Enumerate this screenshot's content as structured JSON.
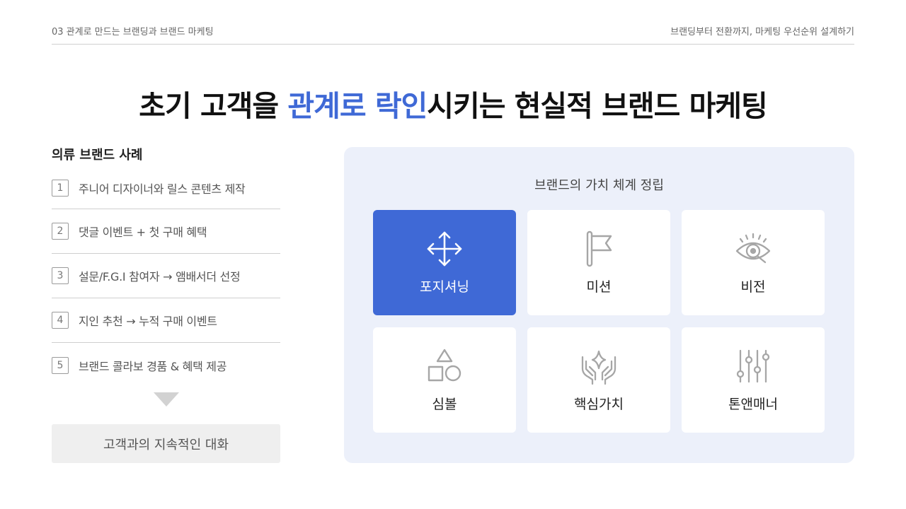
{
  "header": {
    "left": "03 관계로 만드는 브랜딩과 브랜드 마케팅",
    "right": "브랜딩부터 전환까지, 마케팅 우선순위 설계하기"
  },
  "title": {
    "part1": "초기 고객을 ",
    "highlight": "관계로 락인",
    "part2": "시키는 현실적 브랜드 마케팅"
  },
  "case": {
    "title": "의류 브랜드 사례",
    "steps": [
      {
        "num": "1",
        "text": "주니어 디자이너와 릴스 콘텐츠 제작"
      },
      {
        "num": "2",
        "text": "댓글 이벤트 + 첫 구매 혜택"
      },
      {
        "num": "3",
        "text": "설문/F.G.I 참여자 → 앰배서더 선정"
      },
      {
        "num": "4",
        "text": "지인 추천 → 누적 구매 이벤트"
      },
      {
        "num": "5",
        "text": "브랜드 콜라보 경품 & 혜택 제공"
      }
    ],
    "result": "고객과의 지속적인 대화"
  },
  "panel": {
    "title": "브랜드의 가치 체계 정립",
    "cards": [
      {
        "label": "포지셔닝",
        "icon": "move-arrows-icon",
        "active": true
      },
      {
        "label": "미션",
        "icon": "flag-icon",
        "active": false
      },
      {
        "label": "비전",
        "icon": "eye-icon",
        "active": false
      },
      {
        "label": "심볼",
        "icon": "shapes-icon",
        "active": false
      },
      {
        "label": "핵심가치",
        "icon": "hands-star-icon",
        "active": false
      },
      {
        "label": "톤앤매너",
        "icon": "sliders-icon",
        "active": false
      }
    ]
  },
  "colors": {
    "accent": "#3f69d6",
    "panel_bg": "#ecf0fa",
    "icon_gray": "#a6a6a6"
  }
}
